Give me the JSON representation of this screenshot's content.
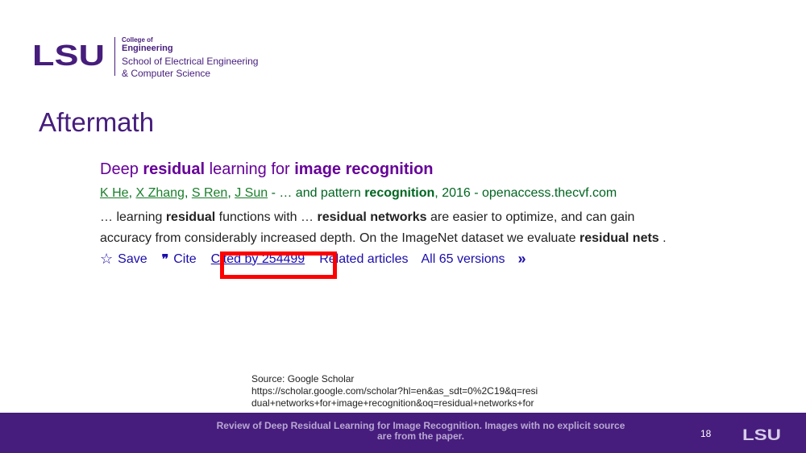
{
  "header": {
    "logo_text": "LSU",
    "college_of": "College of",
    "college_name": "Engineering",
    "school_line1": "School of Electrical Engineering",
    "school_line2": "& Computer Science"
  },
  "slide_title": "Aftermath",
  "scholar": {
    "title_parts": [
      "Deep ",
      "residual",
      " learning for ",
      "image recognition"
    ],
    "authors": [
      "K He",
      "X Zhang",
      "S Ren",
      "J Sun"
    ],
    "author_sep": ", ",
    "meta_prefix": " - … and pattern ",
    "meta_bold": "recognition",
    "meta_suffix": ", 2016 - openaccess.thecvf.com",
    "snippet_line1": [
      "… learning ",
      "residual",
      " functions with … ",
      "residual networks",
      " are easier to optimize, and can gain"
    ],
    "snippet_line2": [
      "accuracy from considerably increased depth. On the ImageNet dataset we evaluate ",
      "residual nets",
      " ."
    ],
    "actions": {
      "save": "Save",
      "cite": "Cite",
      "cited_by": "Cited by 254499",
      "related": "Related articles",
      "versions": "All 65 versions"
    },
    "icons": [
      "star-icon",
      "quote-icon",
      "double-chevron-right-icon"
    ]
  },
  "source": {
    "line1": "Source: Google Scholar",
    "line2": "https://scholar.google.com/scholar?hl=en&as_sdt=0%2C19&q=resi",
    "line3": "dual+networks+for+image+recognition&oq=residual+networks+for"
  },
  "footer": {
    "text_line1": "Review of Deep Residual Learning for Image Recognition. Images with no explicit source",
    "text_line2": "are from the paper.",
    "slide_number": "18",
    "logo_text": "LSU"
  },
  "colors": {
    "brand_purple": "#461d7c",
    "scholar_title": "#660099",
    "scholar_green": "#006621",
    "scholar_link": "#1a0dab",
    "highlight_red": "#ff0000"
  }
}
